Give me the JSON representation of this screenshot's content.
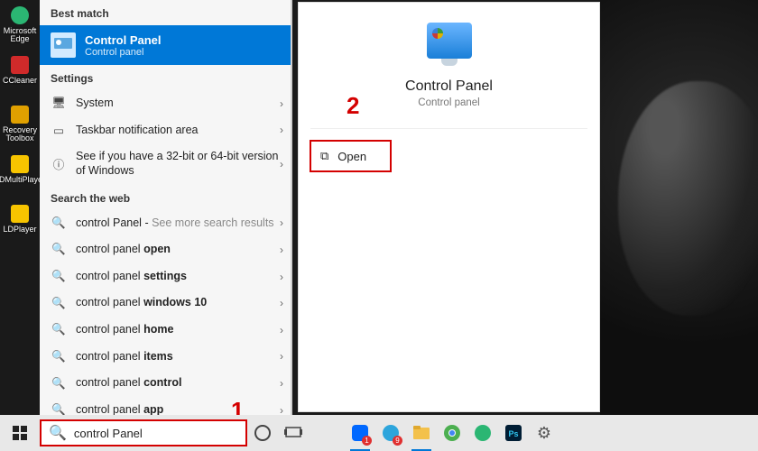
{
  "desktop": {
    "icons": [
      {
        "label": "Microsoft Edge",
        "color": "#2bb673"
      },
      {
        "label": "CCleaner",
        "color": "#d02a2a"
      },
      {
        "label": "Recovery Toolbox",
        "color": "#e0a000"
      },
      {
        "label": "LDMultiPlayer",
        "color": "#f7c400"
      },
      {
        "label": "LDPlayer",
        "color": "#f7c400"
      }
    ]
  },
  "search": {
    "best_match_header": "Best match",
    "best_match": {
      "title": "Control Panel",
      "subtitle": "Control panel"
    },
    "settings_header": "Settings",
    "settings": [
      {
        "label": "System"
      },
      {
        "label": "Taskbar notification area"
      },
      {
        "label": "See if you have a 32-bit or 64-bit version of Windows"
      }
    ],
    "web_header": "Search the web",
    "web": [
      {
        "prefix": "control Panel",
        "suffix": " - ",
        "muted": "See more search results"
      },
      {
        "prefix": "control panel ",
        "bold": "open"
      },
      {
        "prefix": "control panel ",
        "bold": "settings"
      },
      {
        "prefix": "control panel ",
        "bold": "windows 10"
      },
      {
        "prefix": "control panel ",
        "bold": "home"
      },
      {
        "prefix": "control panel ",
        "bold": "items"
      },
      {
        "prefix": "control panel ",
        "bold": "control"
      },
      {
        "prefix": "control panel ",
        "bold": "app"
      }
    ]
  },
  "preview": {
    "title": "Control Panel",
    "subtitle": "Control panel",
    "open_label": "Open"
  },
  "taskbar": {
    "search_value": "control Panel",
    "items": [
      {
        "name": "cortana-circle",
        "color": "#444"
      },
      {
        "name": "taskview",
        "color": "#444"
      },
      {
        "name": "zalo",
        "color": "#0068ff",
        "badge": "1",
        "active": true
      },
      {
        "name": "telegram",
        "color": "#2da5dc",
        "badge": "9"
      },
      {
        "name": "explorer",
        "color": "#f3c14b",
        "active": true
      },
      {
        "name": "chrome",
        "color": "#4caf50"
      },
      {
        "name": "edge",
        "color": "#2bb673"
      },
      {
        "name": "photoshop",
        "color": "#001d34"
      },
      {
        "name": "settings",
        "color": "#555"
      }
    ]
  },
  "annotations": {
    "one": "1",
    "two": "2"
  },
  "icons": {
    "search": "🔍",
    "chevron": "›",
    "gear": "⚙",
    "monitor": "🖥",
    "info": "ⓘ",
    "taskbar_glyph": "▭",
    "open": "⧉"
  }
}
